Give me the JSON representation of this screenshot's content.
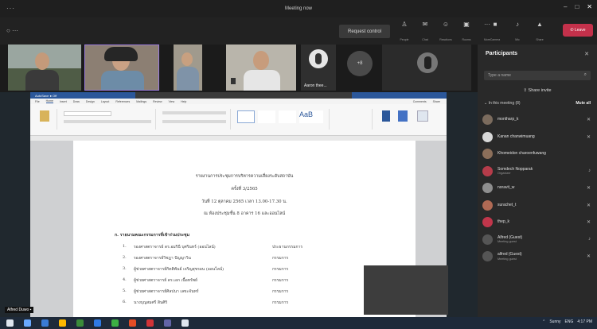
{
  "window": {
    "title": "Meeting now",
    "controls": [
      "–",
      "□",
      "✕"
    ]
  },
  "toolbar": {
    "status": "○ ···",
    "request_control": "Request control",
    "icons": [
      {
        "icon": "people-icon",
        "label": "People"
      },
      {
        "icon": "chat-icon",
        "label": "Chat"
      },
      {
        "icon": "reactions-icon",
        "label": "Reactions"
      },
      {
        "icon": "rooms-icon",
        "label": "Rooms"
      },
      {
        "icon": "more-icon",
        "label": "More"
      }
    ],
    "right_icons": [
      {
        "icon": "camera-icon",
        "label": "Camera"
      },
      {
        "icon": "mic-icon",
        "label": "Mic"
      },
      {
        "icon": "share-icon",
        "label": "Share"
      }
    ],
    "leave": "✆ Leave"
  },
  "video_strip": {
    "tiles": [
      {
        "name": "",
        "bg": "#7d8a82"
      },
      {
        "name": "",
        "bg": "#8f8176"
      },
      {
        "name": "",
        "bg": "#9a9486"
      },
      {
        "name": "",
        "bg": "#a9a49a"
      },
      {
        "name": "Aaron thee...",
        "bg": "#303030"
      },
      {
        "name": "",
        "bg": "#3c3c3c"
      },
      {
        "name": "",
        "bg": "#303030"
      }
    ],
    "counter": "+8"
  },
  "word": {
    "title": "AutoSave  ● Off",
    "tabs": [
      "File",
      "Home",
      "Insert",
      "Draw",
      "Design",
      "Layout",
      "References",
      "Mailings",
      "Review",
      "View",
      "Help"
    ],
    "comments": "Comments",
    "share": "Share"
  },
  "doc": {
    "heading1": "รายงานการประชุมการบริหารความเสี่ยงระดับสถาบัน",
    "heading2": "ครั้งที่ 3/2565",
    "heading3": "วันที่ 12 ตุลาคม 2565 เวลา 13.00-17.30 น.",
    "heading4": "ณ ห้องประชุมชั้น 8 อาคาร 16 และออนไลน์",
    "section": "ก. รายนามคณะกรรมการที่เข้าร่วมประชุม",
    "rows": [
      {
        "n": "1.",
        "t": "รองศาสตราจารย์ ดร.อมรินี บุศรินทร์ (ออนไลน์)",
        "p": "ประธานกรรมการ"
      },
      {
        "n": "2.",
        "t": "รองศาสตราจารย์วิชฎา ปัญญาวิน",
        "p": "กรรมการ"
      },
      {
        "n": "3.",
        "t": "ผู้ช่วยศาสตราจารย์กิตติพันธ์ เจริญสุขรอน (ออนไลน์)",
        "p": "กรรมการ"
      },
      {
        "n": "4.",
        "t": "ผู้ช่วยศาสตราจารย์ ดร.เอก เนื้อทรัพย์",
        "p": "กรรมการ"
      },
      {
        "n": "5.",
        "t": "ผู้ช่วยศาสตราจารย์ศิลปนา เลขะจันทร์",
        "p": "กรรมการ"
      },
      {
        "n": "6.",
        "t": "นางบุญสมศรี สินศิริ",
        "p": "กรรมการ"
      }
    ],
    "screen_label": "Alfred Duwo ▪"
  },
  "participants": {
    "title": "Participants",
    "close": "✕",
    "search_placeholder": "Type a name",
    "search_icon": "⌕",
    "share_invite": "⇪  Share invite",
    "in_meeting": "⌄ In this meeting (8)",
    "mute_all": "Mute all",
    "list": [
      {
        "name": "montharp_k",
        "sub": "",
        "color": "#7b6b5d"
      },
      {
        "name": "Kanan chanwimuang",
        "sub": "",
        "color": "#d8d8d8"
      },
      {
        "name": "Khomeidon charoenfuwang",
        "sub": "",
        "color": "#8c6f5a"
      },
      {
        "name": "Somdech Nopparak",
        "sub": "Organizer",
        "color": "#b63c4a"
      },
      {
        "name": "noravit_w",
        "sub": "",
        "color": "#8e8e8e"
      },
      {
        "name": "surachet_t",
        "sub": "",
        "color": "#b06a54"
      },
      {
        "name": "thep_k",
        "sub": "",
        "color": "#c1364b"
      },
      {
        "name": "Alfred (Guest)",
        "sub": "Meeting guest",
        "color": "#555555"
      },
      {
        "name": "alfred (Guest)",
        "sub": "Meeting guest",
        "color": "#555555"
      }
    ]
  },
  "taskbar": {
    "icon_colors": [
      "#dfe6ef",
      "#6aa9ff",
      "#3a7bd5",
      "#ffb900",
      "#3a8c3a",
      "#2f7ae5",
      "#3cb043",
      "#e44d26",
      "#d13438",
      "#6264a7"
    ],
    "tray": [
      "⌃",
      "Sunny",
      "ENG",
      "4:17 PM"
    ]
  }
}
